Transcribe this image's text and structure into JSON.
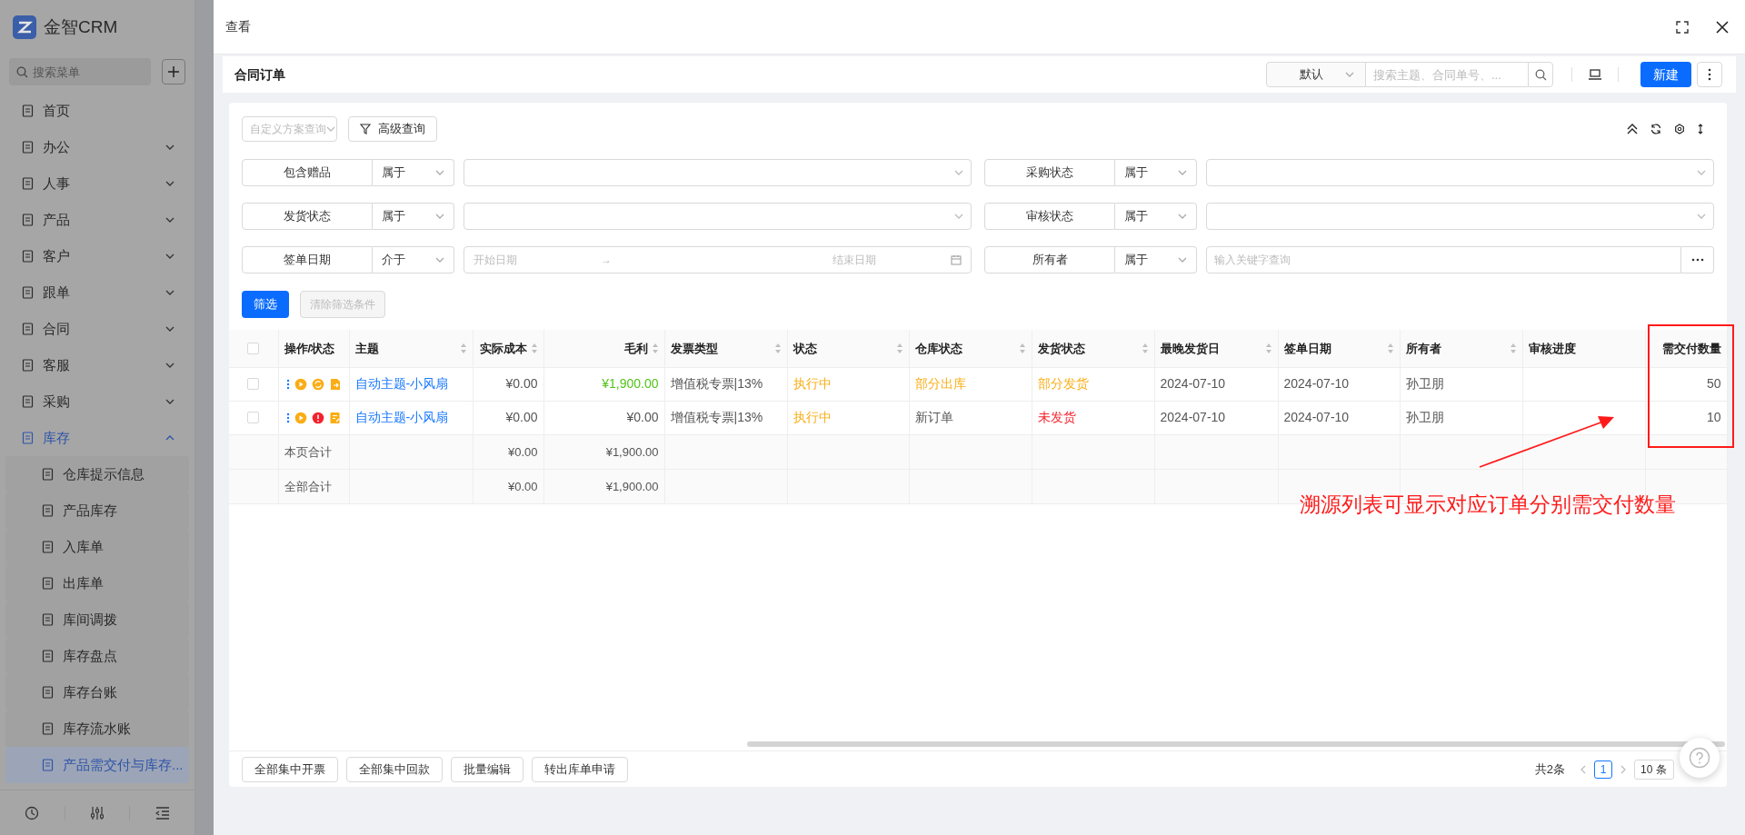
{
  "app": {
    "name": "金智CRM"
  },
  "sidebar": {
    "search_placeholder": "搜索菜单",
    "items": [
      {
        "label": "首页",
        "selected": false
      },
      {
        "label": "办公",
        "selected": false,
        "expanded": false
      },
      {
        "label": "人事",
        "selected": false,
        "expanded": false
      },
      {
        "label": "产品",
        "selected": false,
        "expanded": false
      },
      {
        "label": "客户",
        "selected": false,
        "expanded": false
      },
      {
        "label": "跟单",
        "selected": false,
        "expanded": false
      },
      {
        "label": "合同",
        "selected": false,
        "expanded": false
      },
      {
        "label": "客服",
        "selected": false,
        "expanded": false
      },
      {
        "label": "采购",
        "selected": false,
        "expanded": false
      },
      {
        "label": "库存",
        "selected": false,
        "expanded": true,
        "children": [
          {
            "label": "仓库提示信息",
            "selected": false
          },
          {
            "label": "产品库存",
            "selected": false
          },
          {
            "label": "入库单",
            "selected": false
          },
          {
            "label": "出库单",
            "selected": false
          },
          {
            "label": "库间调拨",
            "selected": false
          },
          {
            "label": "库存盘点",
            "selected": false
          },
          {
            "label": "库存台账",
            "selected": false
          },
          {
            "label": "库存流水账",
            "selected": false
          },
          {
            "label": "产品需交付与库存...",
            "selected": true
          }
        ]
      }
    ]
  },
  "dialog": {
    "title": "查看"
  },
  "list_header": {
    "title": "合同订单",
    "view_select": "默认",
    "search_placeholder": "搜索主题、合同单号、...",
    "new_button": "新建"
  },
  "query": {
    "scheme_placeholder": "自定义方案查询",
    "advanced_button": "高级查询"
  },
  "filters": [
    {
      "label": "包含赠品",
      "operator": "属于",
      "kind": "select"
    },
    {
      "label": "采购状态",
      "operator": "属于",
      "kind": "select"
    },
    {
      "label": "发货状态",
      "operator": "属于",
      "kind": "select"
    },
    {
      "label": "审核状态",
      "operator": "属于",
      "kind": "select"
    },
    {
      "label": "签单日期",
      "operator": "介于",
      "kind": "date_range",
      "start_placeholder": "开始日期",
      "range_separator": "→",
      "end_placeholder": "结束日期"
    },
    {
      "label": "所有者",
      "operator": "属于",
      "kind": "keyword",
      "placeholder": "输入关键字查询"
    }
  ],
  "filter_buttons": {
    "apply": "筛选",
    "clear": {
      "label": "清除筛选条件",
      "disabled": true
    }
  },
  "table": {
    "all_checked": false,
    "columns": [
      {
        "label": "操作/状态",
        "sortable": false,
        "align_right": false
      },
      {
        "label": "主题",
        "sortable": true,
        "align_right": false
      },
      {
        "label": "实际成本",
        "sortable": true,
        "align_right": true
      },
      {
        "label": "毛利",
        "sortable": true,
        "align_right": true
      },
      {
        "label": "发票类型",
        "sortable": true,
        "align_right": false
      },
      {
        "label": "状态",
        "sortable": true,
        "align_right": false
      },
      {
        "label": "仓库状态",
        "sortable": true,
        "align_right": false
      },
      {
        "label": "发货状态",
        "sortable": true,
        "align_right": false
      },
      {
        "label": "最晚发货日",
        "sortable": true,
        "align_right": false
      },
      {
        "label": "签单日期",
        "sortable": true,
        "align_right": false
      },
      {
        "label": "所有者",
        "sortable": true,
        "align_right": false
      },
      {
        "label": "审核进度",
        "sortable": false,
        "align_right": false
      },
      {
        "label": "需交付数量",
        "sortable": false,
        "align_right": true
      }
    ],
    "rows": [
      {
        "selected": false,
        "cells": [
          {
            "status_icons": [
              {
                "kind": "more",
                "color": "#1677ff"
              },
              {
                "kind": "play",
                "color": "#faad14"
              },
              {
                "kind": "sync",
                "color": "#faad14"
              },
              {
                "kind": "export",
                "color": "#faad14"
              }
            ]
          },
          {
            "text": "自动主题-小风扇",
            "color": "#1677ff"
          },
          {
            "text": "¥0.00"
          },
          {
            "text": "¥1,900.00",
            "color": "#52c41a"
          },
          {
            "text": "增值税专票|13%"
          },
          {
            "text": "执行中",
            "color": "#faad14"
          },
          {
            "text": "部分出库",
            "color": "#faad14"
          },
          {
            "text": "部分发货",
            "color": "#faad14"
          },
          {
            "text": "2024-07-10"
          },
          {
            "text": "2024-07-10"
          },
          {
            "text": "孙卫朋"
          },
          {
            "text": ""
          },
          {
            "text": "50"
          }
        ]
      },
      {
        "selected": false,
        "cells": [
          {
            "status_icons": [
              {
                "kind": "more",
                "color": "#1677ff"
              },
              {
                "kind": "play",
                "color": "#faad14"
              },
              {
                "kind": "alert",
                "color": "#f5222d"
              },
              {
                "kind": "edit",
                "color": "#faad14"
              }
            ]
          },
          {
            "text": "自动主题-小风扇",
            "color": "#1677ff"
          },
          {
            "text": "¥0.00"
          },
          {
            "text": "¥0.00"
          },
          {
            "text": "增值税专票|13%"
          },
          {
            "text": "执行中",
            "color": "#faad14"
          },
          {
            "text": "新订单"
          },
          {
            "text": "未发货",
            "color": "#f5222d"
          },
          {
            "text": "2024-07-10"
          },
          {
            "text": "2024-07-10"
          },
          {
            "text": "孙卫朋"
          },
          {
            "text": ""
          },
          {
            "text": "10"
          }
        ]
      }
    ],
    "summary_rows": [
      [
        "本页合计",
        "",
        "¥0.00",
        "¥1,900.00"
      ],
      [
        "全部合计",
        "",
        "¥0.00",
        "¥1,900.00"
      ]
    ]
  },
  "bulk_buttons": [
    "全部集中开票",
    "全部集中回款",
    "批量编辑",
    "转出库单申请"
  ],
  "pagination": {
    "total": "共2条",
    "pages": [
      {
        "label": "1",
        "selected": true
      }
    ],
    "page_size": "10 条"
  },
  "annotation": {
    "text": "溯源列表可显示对应订单分别需交付数量"
  }
}
